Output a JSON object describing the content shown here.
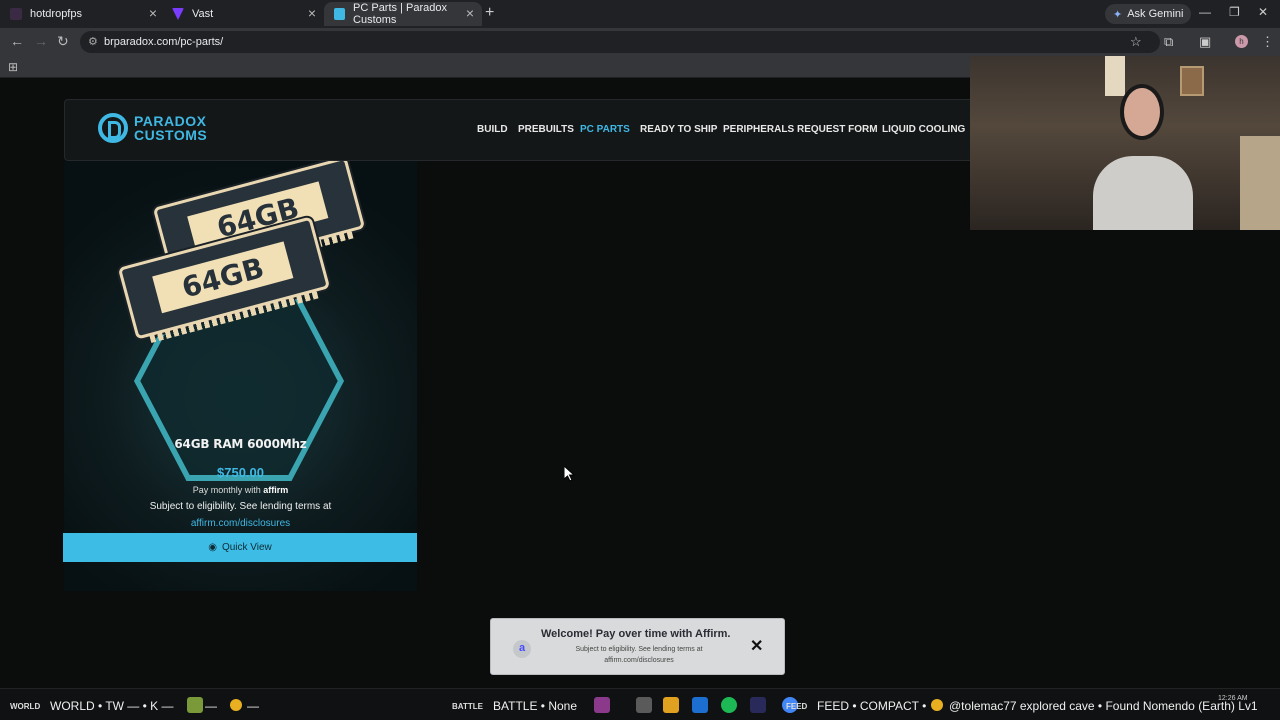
{
  "browser": {
    "tabs": [
      {
        "title": "hotdropfps",
        "fav_color": "#3a2a44"
      },
      {
        "title": "Vast",
        "fav_color": "#7a3cff"
      },
      {
        "title": "PC Parts | Paradox Customs",
        "fav_color": "#3fb8e4"
      }
    ],
    "gemini_label": "Ask Gemini",
    "url": "brparadox.com/pc-parts/",
    "avatar_letter": "h"
  },
  "site": {
    "logo_line1": "PARADOX",
    "logo_line2": "CUSTOMS",
    "nav": [
      "BUILD",
      "PREBUILTS",
      "PC PARTS",
      "READY TO SHIP",
      "PERIPHERALS",
      "REQUEST FORM",
      "LIQUID COOLING"
    ],
    "accent": "#3fb8e4"
  },
  "product": {
    "ram_label": "64GB",
    "title": "64GB RAM 6000Mhz",
    "price": "$750.00",
    "affirm_line1": "Pay monthly with",
    "affirm_brand": "affirm",
    "affirm_line2": "Subject to eligibility. See lending terms at",
    "affirm_link": "affirm.com/disclosures",
    "quick_view": "Quick View"
  },
  "toast": {
    "logo": "a",
    "title": "Welcome! Pay over time with Affirm.",
    "line1": "Subject to eligibility. See lending terms at",
    "line2": "affirm.com/disclosures",
    "close": "✕"
  },
  "taskbar": {
    "world_tag": "WORLD",
    "world_text": "WORLD • TW — • K —",
    "battle_tag": "BATTLE",
    "battle_text": "BATTLE • None",
    "feed_tag": "FEED",
    "feed_text": "FEED • COMPACT •",
    "ticker": "@tolemac77 explored cave • Found Nomendo (Earth) Lv1",
    "clock": "12:26 AM"
  }
}
